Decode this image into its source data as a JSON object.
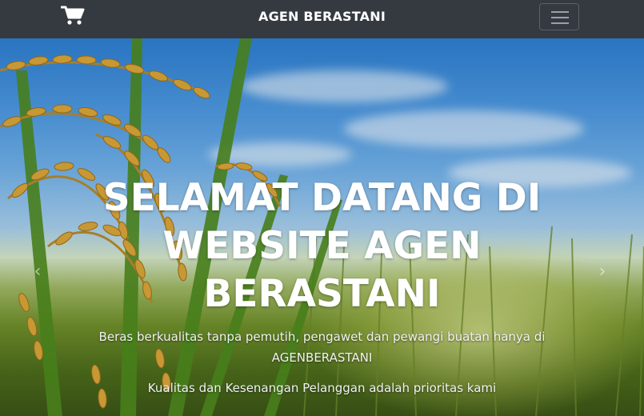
{
  "navbar": {
    "brand": "AGEN BERASTANI",
    "cart_icon": "shopping-cart-icon",
    "toggler_icon": "hamburger-menu-icon"
  },
  "hero": {
    "title": "SELAMAT DATANG DI WEBSITE AGEN BERASTANI",
    "subtitle_line1": "Beras berkualitas tanpa pemutih, pengawet dan pewangi buatan hanya di AGENBERASTANI",
    "subtitle_line2": "Kualitas dan Kesenangan Pelanggan adalah prioritas kami",
    "prev_icon": "chevron-left-icon",
    "next_icon": "chevron-right-icon",
    "prev_glyph": "‹",
    "next_glyph": "›"
  },
  "colors": {
    "navbar_bg": "#343a40",
    "brand_text": "#ffffff",
    "caption_text": "#ffffff"
  }
}
